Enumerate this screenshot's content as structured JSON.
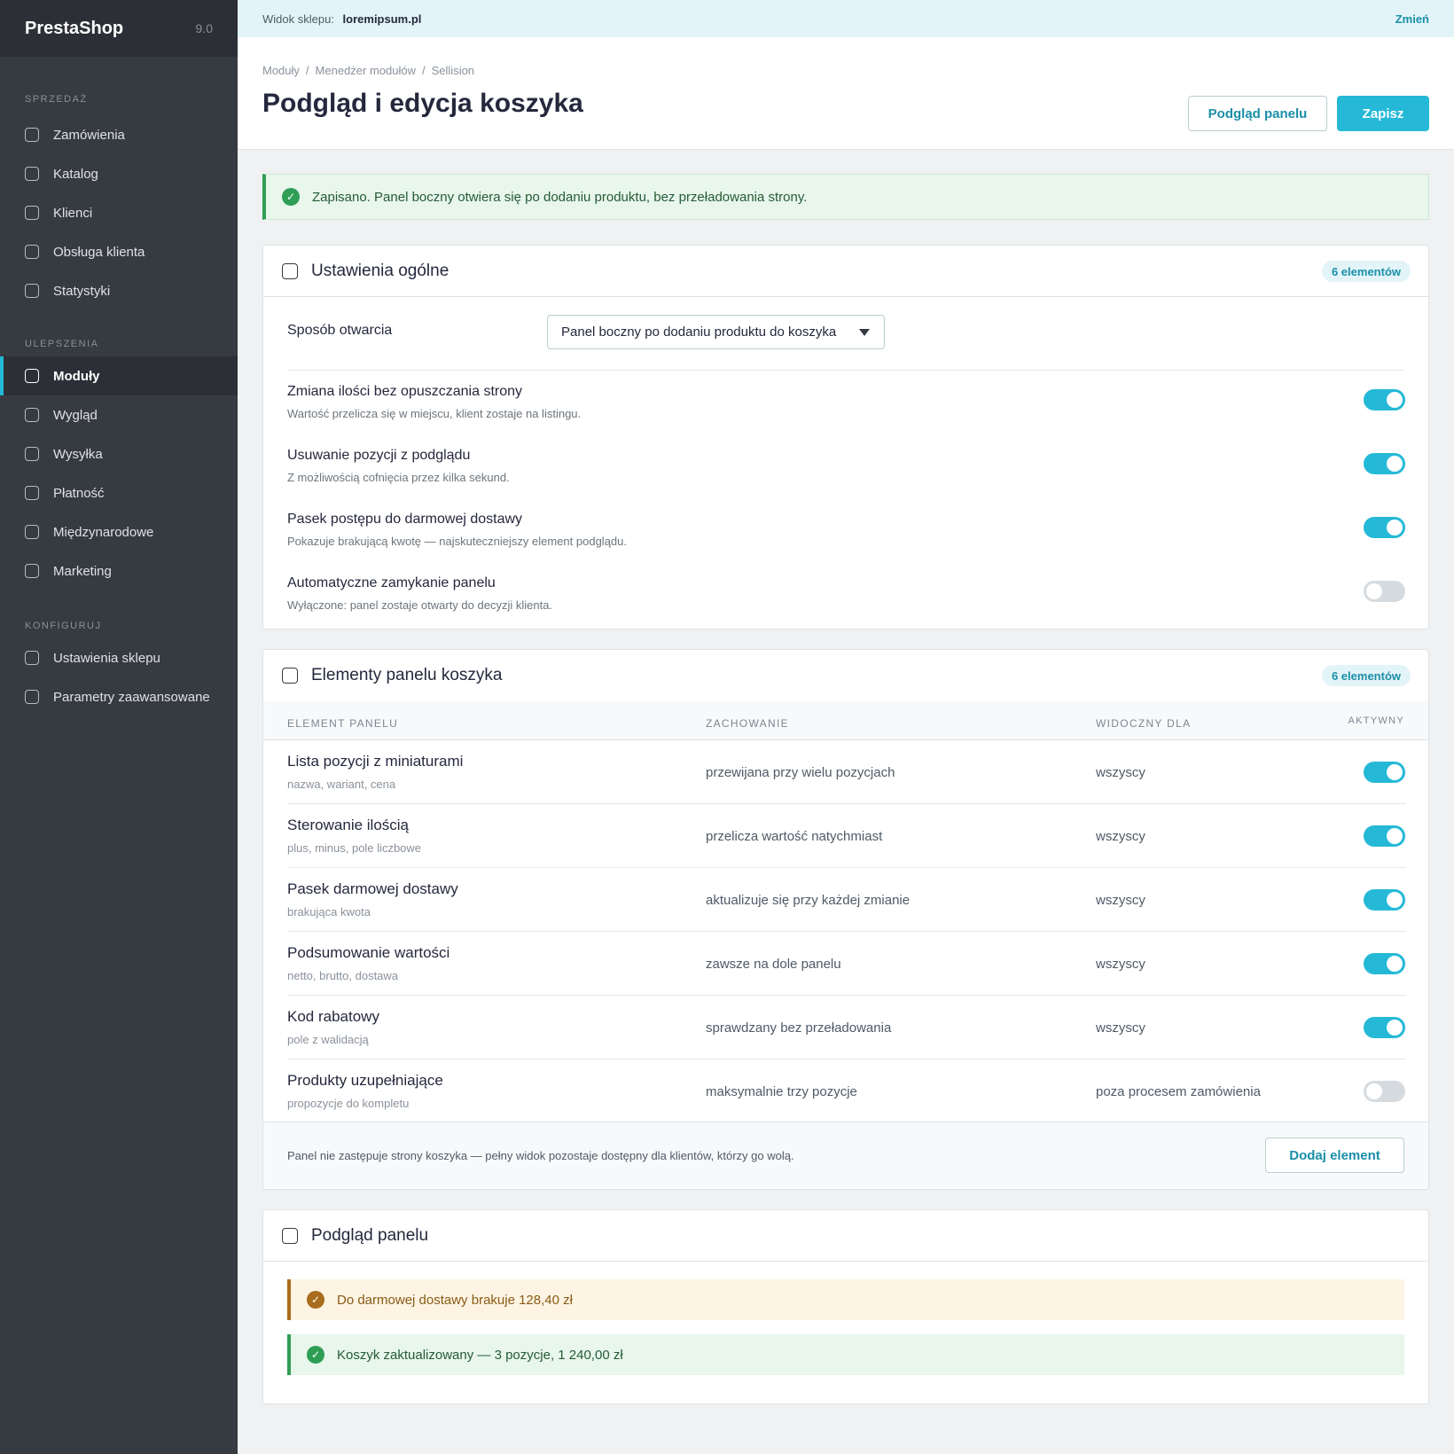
{
  "brand": {
    "name": "PrestaShop",
    "version": "9.0"
  },
  "sidebar": {
    "sections": [
      {
        "title": "SPRZEDAŻ",
        "items": [
          "Zamówienia",
          "Katalog",
          "Klienci",
          "Obsługa klienta",
          "Statystyki"
        ]
      },
      {
        "title": "ULEPSZENIA",
        "items": [
          "Moduły",
          "Wygląd",
          "Wysyłka",
          "Płatność",
          "Międzynarodowe",
          "Marketing"
        ]
      },
      {
        "title": "KONFIGURUJ",
        "items": [
          "Ustawienia sklepu",
          "Parametry zaawansowane"
        ]
      }
    ],
    "active_item": "Moduły"
  },
  "topbar": {
    "label": "Widok sklepu:",
    "shop": "loremipsum.pl",
    "change": "Zmień"
  },
  "breadcrumb": [
    "Moduły",
    "Menedżer modułów",
    "Sellision"
  ],
  "page_title": "Podgląd i edycja koszyka",
  "buttons": {
    "preview": "Podgląd panelu",
    "save": "Zapisz"
  },
  "success_message": "Zapisano. Panel boczny otwiera się po dodaniu produktu, bez przeładowania strony.",
  "general": {
    "title": "Ustawienia ogólne",
    "count": "6 elementów",
    "open_mode_label": "Sposób otwarcia",
    "open_mode_value": "Panel boczny po dodaniu produktu do koszyka",
    "settings": [
      {
        "label": "Zmiana ilości bez opuszczania strony",
        "desc": "Wartość przelicza się w miejscu, klient zostaje na listingu.",
        "enabled": true
      },
      {
        "label": "Usuwanie pozycji z podglądu",
        "desc": "Z możliwością cofnięcia przez kilka sekund.",
        "enabled": true
      },
      {
        "label": "Pasek postępu do darmowej dostawy",
        "desc": "Pokazuje brakującą kwotę — najskuteczniejszy element podglądu.",
        "enabled": true
      },
      {
        "label": "Automatyczne zamykanie panelu",
        "desc": "Wyłączone: panel zostaje otwarty do decyzji klienta.",
        "enabled": false
      }
    ]
  },
  "elements": {
    "title": "Elementy panelu koszyka",
    "count": "6 elementów",
    "columns": [
      "ELEMENT PANELU",
      "ZACHOWANIE",
      "WIDOCZNY DLA",
      "AKTYWNY"
    ],
    "rows": [
      {
        "name": "Lista pozycji z miniaturami",
        "sub": "nazwa, wariant, cena",
        "behavior": "przewijana przy wielu pozycjach",
        "visible": "wszyscy",
        "active": true
      },
      {
        "name": "Sterowanie ilością",
        "sub": "plus, minus, pole liczbowe",
        "behavior": "przelicza wartość natychmiast",
        "visible": "wszyscy",
        "active": true
      },
      {
        "name": "Pasek darmowej dostawy",
        "sub": "brakująca kwota",
        "behavior": "aktualizuje się przy każdej zmianie",
        "visible": "wszyscy",
        "active": true
      },
      {
        "name": "Podsumowanie wartości",
        "sub": "netto, brutto, dostawa",
        "behavior": "zawsze na dole panelu",
        "visible": "wszyscy",
        "active": true
      },
      {
        "name": "Kod rabatowy",
        "sub": "pole z walidacją",
        "behavior": "sprawdzany bez przeładowania",
        "visible": "wszyscy",
        "active": true
      },
      {
        "name": "Produkty uzupełniające",
        "sub": "propozycje do kompletu",
        "behavior": "maksymalnie trzy pozycje",
        "visible": "poza procesem zamówienia",
        "active": false
      }
    ],
    "footer_note": "Panel nie zastępuje strony koszyka — pełny widok pozostaje dostępny dla klientów, którzy go wolą.",
    "add_button": "Dodaj element"
  },
  "preview": {
    "title": "Podgląd panelu",
    "notice_shipping": "Do darmowej dostawy brakuje 128,40 zł",
    "notice_cart": "Koszyk zaktualizowany — 3 pozycje, 1 240,00 zł"
  },
  "colors": {
    "accent": "#25b9d7",
    "sidebar": "#363a41",
    "success": "#2f9e55",
    "warning": "#a86d1d"
  }
}
